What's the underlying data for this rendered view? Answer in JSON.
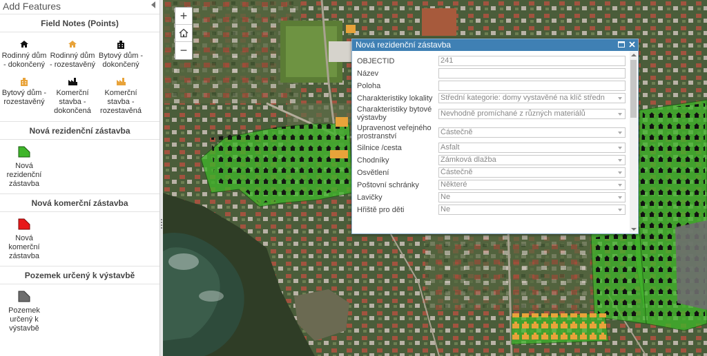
{
  "panel": {
    "title": "Add Features",
    "sections": [
      {
        "title": "Field Notes (Points)",
        "items": [
          {
            "label": "Rodinný dům - dokončený",
            "color": "#111111"
          },
          {
            "label": "Rodinný dům - rozestavěný",
            "color": "#e8a33a"
          },
          {
            "label": "Bytový dům - dokončený",
            "color": "#111111"
          },
          {
            "label": "Bytový dům - rozestavěný",
            "color": "#e8a33a"
          },
          {
            "label": "Komerční stavba - dokončená",
            "color": "#111111"
          },
          {
            "label": "Komerční stavba - rozestavěná",
            "color": "#e8a33a"
          }
        ]
      },
      {
        "title": "Nová rezidenční zástavba",
        "items": [
          {
            "label": "Nová rezidenční zástavba",
            "color": "#3fb52a"
          }
        ]
      },
      {
        "title": "Nová komerční zástavba",
        "items": [
          {
            "label": "Nová komerční zástavba",
            "color": "#e8191b"
          }
        ]
      },
      {
        "title": "Pozemek určený k výstavbě",
        "items": [
          {
            "label": "Pozemek určený k výstavbě",
            "color": "#6e6e6e"
          }
        ]
      }
    ]
  },
  "map": {
    "zoom_in": "+",
    "zoom_out": "−",
    "home_icon": "home-icon"
  },
  "popup": {
    "title": "Nová rezidenční zástavba",
    "fields": [
      {
        "label": "OBJECTID",
        "value": "241",
        "type": "text"
      },
      {
        "label": "Název",
        "value": "",
        "type": "text"
      },
      {
        "label": "Poloha",
        "value": "",
        "type": "text"
      },
      {
        "label": "Charakteristiky lokality",
        "value": "Střední kategorie: domy vystavěné na klíč středn",
        "type": "select"
      },
      {
        "label": "Charakteristiky bytové výstavby",
        "value": "Nevhodně promíchané z různých materiálů",
        "type": "select"
      },
      {
        "label": "Upravenost veřejného prostranství",
        "value": "Částečně",
        "type": "select"
      },
      {
        "label": "Silnice /cesta",
        "value": "Asfalt",
        "type": "select"
      },
      {
        "label": "Chodníky",
        "value": "Zámková dlažba",
        "type": "select"
      },
      {
        "label": "Osvětlení",
        "value": "Částečně",
        "type": "select"
      },
      {
        "label": "Poštovní schránky",
        "value": "Některé",
        "type": "select"
      },
      {
        "label": "Lavičky",
        "value": "Ne",
        "type": "select"
      },
      {
        "label": "Hřiště pro děti",
        "value": "Ne",
        "type": "select"
      }
    ]
  }
}
